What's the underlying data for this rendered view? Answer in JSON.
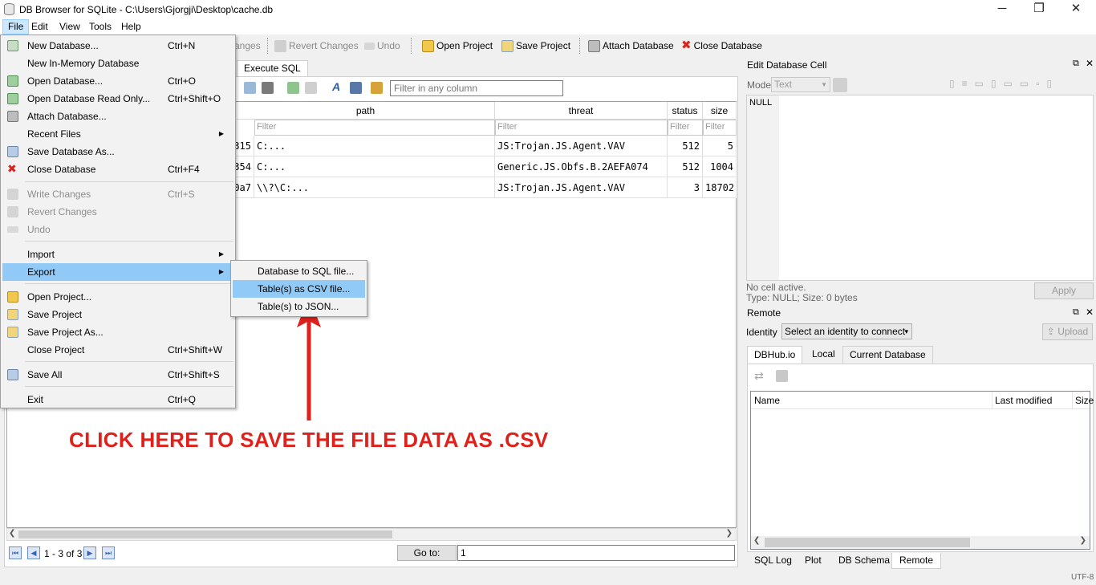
{
  "window": {
    "title": "DB Browser for SQLite - C:\\Users\\Gjorgji\\Desktop\\cache.db",
    "minimize": "─",
    "maximize": "❐",
    "close": "✕"
  },
  "menubar": [
    "File",
    "Edit",
    "View",
    "Tools",
    "Help"
  ],
  "toolbar": {
    "write_changes_partial": "anges",
    "revert_changes": "Revert Changes",
    "undo": "Undo",
    "open_project": "Open Project",
    "save_project": "Save Project",
    "attach_database": "Attach Database",
    "close_database": "Close Database"
  },
  "main": {
    "tab_execute_sql": "Execute SQL",
    "filter_placeholder": "Filter in any column",
    "columns": [
      "path",
      "threat",
      "status",
      "size"
    ],
    "filter_label": "Filter",
    "rows": [
      {
        "id": "315",
        "path": "C:...",
        "threat": "JS:Trojan.JS.Agent.VAV",
        "status": "512",
        "size": "5"
      },
      {
        "id": "354",
        "path": "C:...",
        "threat": "Generic.JS.Obfs.B.2AEFA074",
        "status": "512",
        "size": "1004"
      },
      {
        "id": "0a7",
        "path": "\\\\?\\C:...",
        "threat": "JS:Trojan.JS.Agent.VAV",
        "status": "3",
        "size": "18702"
      }
    ],
    "pager": "1 - 3 of 3",
    "goto_label": "Go to:",
    "goto_value": "1"
  },
  "file_menu": {
    "items": [
      {
        "label": "New Database...",
        "shortcut": "Ctrl+N"
      },
      {
        "label": "New In-Memory Database",
        "shortcut": ""
      },
      {
        "label": "Open Database...",
        "shortcut": "Ctrl+O"
      },
      {
        "label": "Open Database Read Only...",
        "shortcut": "Ctrl+Shift+O"
      },
      {
        "label": "Attach Database...",
        "shortcut": ""
      },
      {
        "label": "Recent Files",
        "shortcut": ""
      },
      {
        "label": "Save Database As...",
        "shortcut": ""
      },
      {
        "label": "Close Database",
        "shortcut": "Ctrl+F4"
      },
      {
        "label": "Write Changes",
        "shortcut": "Ctrl+S"
      },
      {
        "label": "Revert Changes",
        "shortcut": ""
      },
      {
        "label": "Undo",
        "shortcut": ""
      },
      {
        "label": "Import",
        "shortcut": ""
      },
      {
        "label": "Export",
        "shortcut": ""
      },
      {
        "label": "Open Project...",
        "shortcut": ""
      },
      {
        "label": "Save Project",
        "shortcut": ""
      },
      {
        "label": "Save Project As...",
        "shortcut": ""
      },
      {
        "label": "Close Project",
        "shortcut": "Ctrl+Shift+W"
      },
      {
        "label": "Save All",
        "shortcut": "Ctrl+Shift+S"
      },
      {
        "label": "Exit",
        "shortcut": "Ctrl+Q"
      }
    ]
  },
  "export_submenu": {
    "items": [
      "Database to SQL file...",
      "Table(s) as CSV file...",
      "Table(s) to JSON..."
    ]
  },
  "edit_cell": {
    "title": "Edit Database Cell",
    "mode_label": "Mode:",
    "mode_value": "Text",
    "cell_value": "NULL",
    "status1": "No cell active.",
    "status2": "Type: NULL; Size: 0 bytes",
    "apply": "Apply"
  },
  "remote": {
    "title": "Remote",
    "identity_label": "Identity",
    "identity_value": "Select an identity to connect",
    "upload": "Upload",
    "tabs": [
      "DBHub.io",
      "Local",
      "Current Database"
    ],
    "columns": [
      "Name",
      "Last modified",
      "Size"
    ]
  },
  "bottom_tabs": [
    "SQL Log",
    "Plot",
    "DB Schema",
    "Remote"
  ],
  "statusbar": {
    "encoding": "UTF-8"
  },
  "annotation": {
    "text": "CLICK HERE TO SAVE THE FILE DATA AS .CSV",
    "color": "#e0201b"
  },
  "colors": {
    "highlight": "#91c9f7",
    "menu_active": "#cce8ff"
  }
}
